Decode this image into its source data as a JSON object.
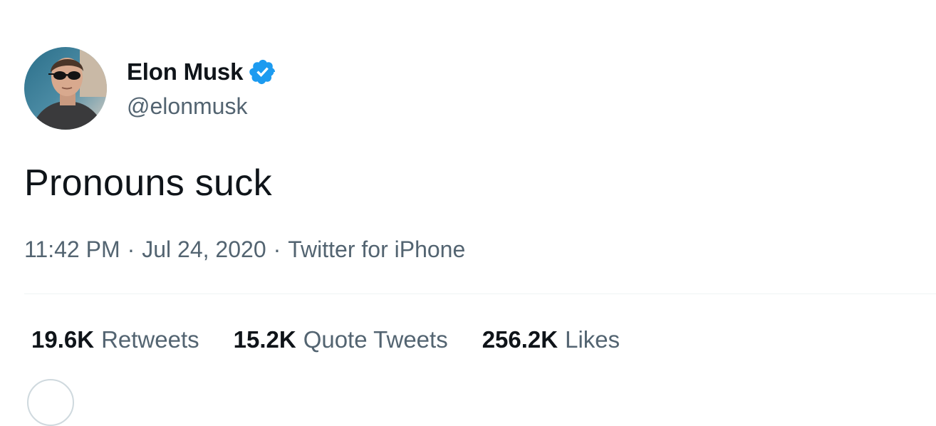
{
  "tweet": {
    "author": {
      "display_name": "Elon Musk",
      "handle": "@elonmusk",
      "verified": true,
      "avatar_icon": "profile-photo",
      "verified_icon": "verified-badge-icon"
    },
    "text": "Pronouns suck",
    "meta": {
      "time": "11:42 PM",
      "separator": "·",
      "date": "Jul 24, 2020",
      "source": "Twitter for iPhone"
    },
    "stats": {
      "retweets": {
        "count": "19.6K",
        "label": "Retweets"
      },
      "quote_tweets": {
        "count": "15.2K",
        "label": "Quote Tweets"
      },
      "likes": {
        "count": "256.2K",
        "label": "Likes"
      }
    }
  },
  "colors": {
    "text_primary": "#0f1419",
    "text_secondary": "#536471",
    "verified_blue": "#1d9bf0",
    "divider": "#eff3f4"
  }
}
